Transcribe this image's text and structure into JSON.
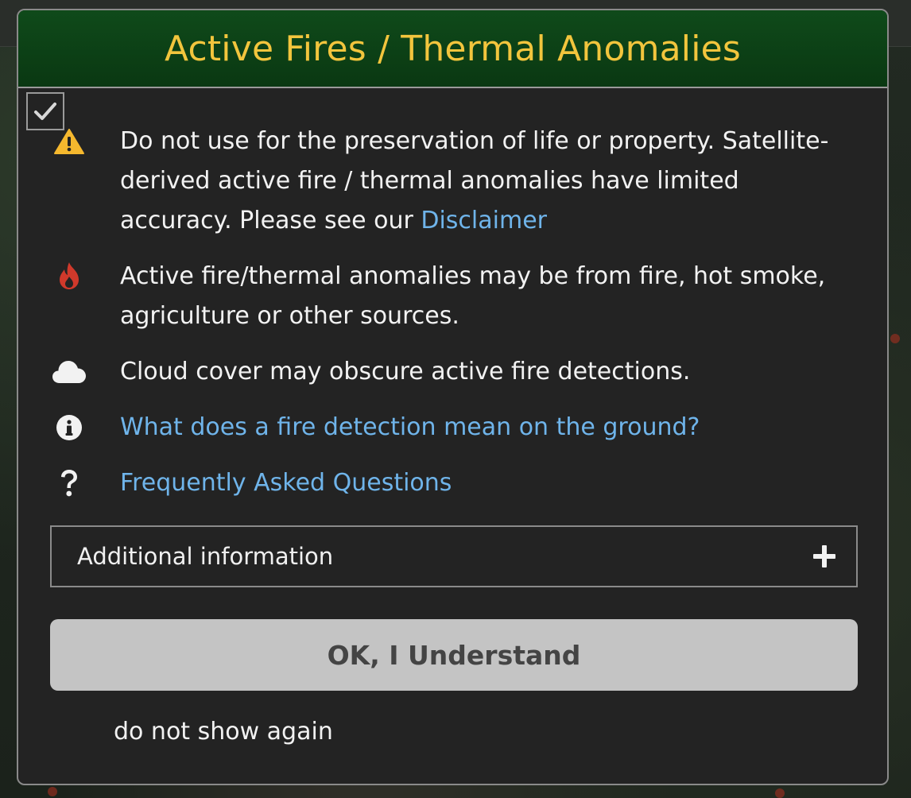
{
  "modal": {
    "title": "Active Fires / Thermal Anomalies",
    "remember_checked": true,
    "notices": [
      {
        "icon": "warning-icon",
        "text": "Do not use for the preservation of life or property. Satellite-derived active fire / thermal anomalies have limited accuracy. Please see our ",
        "link": "Disclaimer"
      },
      {
        "icon": "fire-icon",
        "text": "Active fire/thermal anomalies may be from fire, hot smoke, agriculture or other sources."
      },
      {
        "icon": "cloud-icon",
        "text": "Cloud cover may obscure active fire detections."
      },
      {
        "icon": "info-icon",
        "link": "What does a fire detection mean on the ground?"
      },
      {
        "icon": "question-icon",
        "link": "Frequently Asked Questions"
      }
    ],
    "accordion_label": "Additional information",
    "ok_button": "OK, I Understand",
    "dont_show_again": "do not show again"
  },
  "colors": {
    "title": "#f2c53d",
    "header_bg": "#0f4a1a",
    "link": "#6fb4ea",
    "warning": "#f5b82e",
    "fire": "#d0392b"
  }
}
